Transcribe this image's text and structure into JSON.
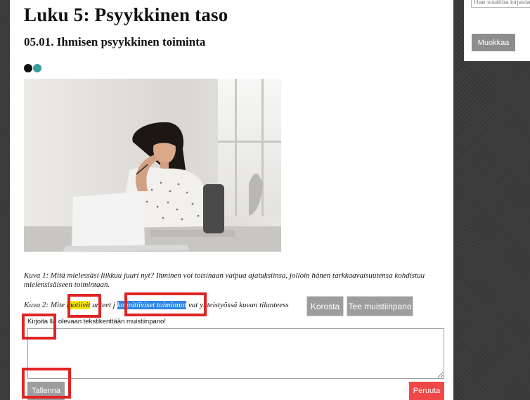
{
  "page": {
    "title": "Luku 5: Psyykkinen taso",
    "section_title": "05.01. Ihmisen psyykkinen toiminta"
  },
  "dots": [
    {
      "name": "black",
      "color": "#111111"
    },
    {
      "name": "teal",
      "color": "#3a9a9a"
    }
  ],
  "captions": {
    "caption1": "Kuva 1: Mitä mielessäsi liikkuu juuri nyt? Ihminen voi toisinaan vaipua ajatuksiinsa, jolloin hänen tarkkaavaisuutensa kohdistuu mielensisäiseen toimintaan.",
    "caption2_part1": "Kuva 2: Mite",
    "caption2_highlight_yellow": "motiivit",
    "caption2_part2": "unteet j",
    "caption2_highlight_blue": "kognitiiviset toiminnot",
    "caption2_part3": "vat yhteistyössä kuvan tilanteess"
  },
  "toolbar": {
    "highlight_label": "Korosta",
    "note_label": "Tee muistiinpano"
  },
  "note": {
    "instruction_part1": "Kirjoita",
    "instruction_part2": "lla olevaan tekstikenttään muistiinpano!",
    "textarea_value": "",
    "save_label": "Tallenna",
    "cancel_label": "Peruuta"
  },
  "sidebar": {
    "search_placeholder": "Hae sisältöa kirjasta",
    "edit_label": "Muokkaa"
  },
  "colors": {
    "highlight_yellow": "#f6e700",
    "highlight_blue": "#2f86e6",
    "annotation_red": "#e02424",
    "button_gray": "#9d9d9d",
    "cancel_red": "#f04848"
  }
}
